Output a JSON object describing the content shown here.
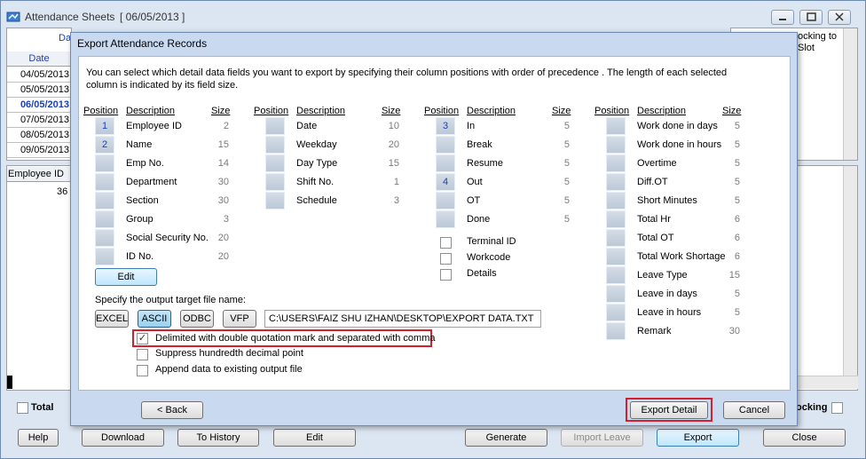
{
  "window": {
    "title": "Attendance Sheets",
    "date": "[ 06/05/2013 ]",
    "bg_text_top_right": "ocking to",
    "bg_text_top_right2": "Slot"
  },
  "background": {
    "date_header_partial": "Dat",
    "date_col_header": "Date",
    "dates": [
      "04/05/2013",
      "05/05/2013",
      "06/05/2013",
      "07/05/2013",
      "08/05/2013",
      "09/05/2013"
    ],
    "selected_date_index": 2,
    "employee_id_header": "Employee ID",
    "employee_id_value": "36",
    "total_label": "Total",
    "ocking_label": "ocking"
  },
  "dialog": {
    "title": "Export Attendance Records",
    "intro_line1": "You can select which detail data fields you want to export by specifying their column positions with order of  precedence . The length of each selected",
    "intro_line2": "column is indicated by its field size.",
    "headers": {
      "position": "Position",
      "description": "Description",
      "size": "Size"
    },
    "group1": [
      {
        "pos": "1",
        "desc": "Employee ID",
        "size": "2"
      },
      {
        "pos": "2",
        "desc": "Name",
        "size": "15"
      },
      {
        "pos": "",
        "desc": "Emp No.",
        "size": "14"
      },
      {
        "pos": "",
        "desc": "Department",
        "size": "30"
      },
      {
        "pos": "",
        "desc": "Section",
        "size": "30"
      },
      {
        "pos": "",
        "desc": "Group",
        "size": "3"
      },
      {
        "pos": "",
        "desc": "Social Security No.",
        "size": "20"
      },
      {
        "pos": "",
        "desc": "ID No.",
        "size": "20"
      }
    ],
    "group2": [
      {
        "pos": "",
        "desc": "Date",
        "size": "10"
      },
      {
        "pos": "",
        "desc": "Weekday",
        "size": "20"
      },
      {
        "pos": "",
        "desc": "Day Type",
        "size": "15"
      },
      {
        "pos": "",
        "desc": "Shift No.",
        "size": "1"
      },
      {
        "pos": "",
        "desc": "Schedule",
        "size": "3"
      }
    ],
    "group3": [
      {
        "pos": "3",
        "desc": "In",
        "size": "5"
      },
      {
        "pos": "",
        "desc": "Break",
        "size": "5"
      },
      {
        "pos": "",
        "desc": "Resume",
        "size": "5"
      },
      {
        "pos": "4",
        "desc": "Out",
        "size": "5"
      },
      {
        "pos": "",
        "desc": "OT",
        "size": "5"
      },
      {
        "pos": "",
        "desc": "Done",
        "size": "5"
      }
    ],
    "group3_checks": [
      "Terminal ID",
      "Workcode",
      "Details"
    ],
    "group4": [
      {
        "pos": "",
        "desc": "Work done in days",
        "size": "5"
      },
      {
        "pos": "",
        "desc": "Work done in hours",
        "size": "5"
      },
      {
        "pos": "",
        "desc": "Overtime",
        "size": "5"
      },
      {
        "pos": "",
        "desc": "Diff.OT",
        "size": "5"
      },
      {
        "pos": "",
        "desc": "Short Minutes",
        "size": "5"
      },
      {
        "pos": "",
        "desc": "Total Hr",
        "size": "6"
      },
      {
        "pos": "",
        "desc": "Total OT",
        "size": "6"
      },
      {
        "pos": "",
        "desc": "Total Work Shortage",
        "size": "6"
      },
      {
        "pos": "",
        "desc": "Leave Type",
        "size": "15"
      },
      {
        "pos": "",
        "desc": "Leave in days",
        "size": "5"
      },
      {
        "pos": "",
        "desc": "Leave in hours",
        "size": "5"
      },
      {
        "pos": "",
        "desc": "Remark",
        "size": "30"
      }
    ],
    "edit_label": "Edit",
    "output_label": "Specify the output target file name:",
    "formats": [
      "EXCEL",
      "ASCII",
      "ODBC",
      "VFP"
    ],
    "selected_format": "ASCII",
    "file_path": "C:\\USERS\\FAIZ SHU IZHAN\\DESKTOP\\EXPORT DATA.TXT",
    "options": [
      {
        "label": "Delimited with double quotation mark and separated with comma",
        "checked": true
      },
      {
        "label": "Suppress hundredth decimal point",
        "checked": false
      },
      {
        "label": "Append data to existing output file",
        "checked": false
      }
    ],
    "back_label": "< Back",
    "export_detail_label": "Export Detail",
    "cancel_label": "Cancel"
  },
  "bottom_bar": {
    "help": "Help",
    "download": "Download",
    "to_history": "To History",
    "edit": "Edit",
    "generate": "Generate",
    "import_leave": "Import Leave",
    "export": "Export",
    "close": "Close"
  },
  "colors": {
    "highlight_red": "#d4202c",
    "position_number": "#1c3fb8",
    "dialog_title_bg": "#c9daf0",
    "selected_date": "#1c3fb8"
  }
}
